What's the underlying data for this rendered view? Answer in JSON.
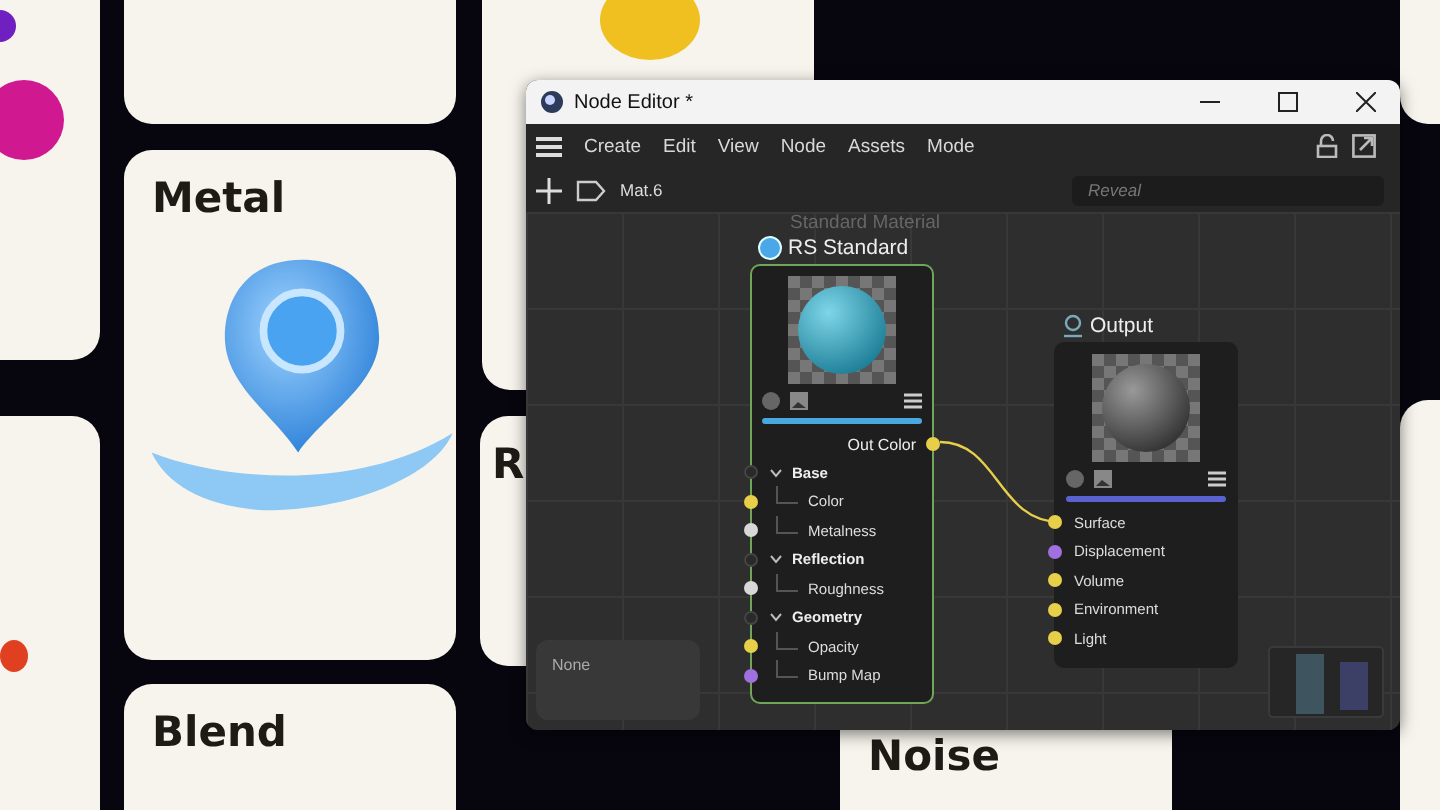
{
  "background_tiles": [
    {
      "label": "Metal"
    },
    {
      "label": "R"
    },
    {
      "label": "Blend"
    },
    {
      "label": "Noise"
    }
  ],
  "window": {
    "title": "Node Editor *"
  },
  "menu": [
    "Create",
    "Edit",
    "View",
    "Node",
    "Assets",
    "Mode"
  ],
  "toolbar": {
    "material": "Mat.6",
    "search": {
      "placeholder": "Reveal"
    }
  },
  "nodes": [
    {
      "kind": "material",
      "caption": "Standard Material",
      "title": "RS Standard",
      "output": {
        "label": "Out Color",
        "color": "#e8cf4a"
      },
      "groups": [
        {
          "label": "Base",
          "expanded": true,
          "children": [
            {
              "label": "Color",
              "color": "#e8cf4a"
            },
            {
              "label": "Metalness",
              "color": "#d8d8d8"
            }
          ]
        },
        {
          "label": "Reflection",
          "expanded": true,
          "children": [
            {
              "label": "Roughness",
              "color": "#d8d8d8"
            }
          ]
        },
        {
          "label": "Geometry",
          "expanded": true,
          "children": [
            {
              "label": "Opacity",
              "color": "#e8cf4a"
            },
            {
              "label": "Bump Map",
              "color": "#a070e0"
            }
          ]
        }
      ]
    },
    {
      "kind": "output",
      "title": "Output",
      "inputs": [
        {
          "label": "Surface",
          "color": "#e8cf4a"
        },
        {
          "label": "Displacement",
          "color": "#a070e0"
        },
        {
          "label": "Volume",
          "color": "#e8cf4a"
        },
        {
          "label": "Environment",
          "color": "#e8cf4a"
        },
        {
          "label": "Light",
          "color": "#e8cf4a"
        }
      ]
    }
  ],
  "info_panel": {
    "text": "None"
  }
}
